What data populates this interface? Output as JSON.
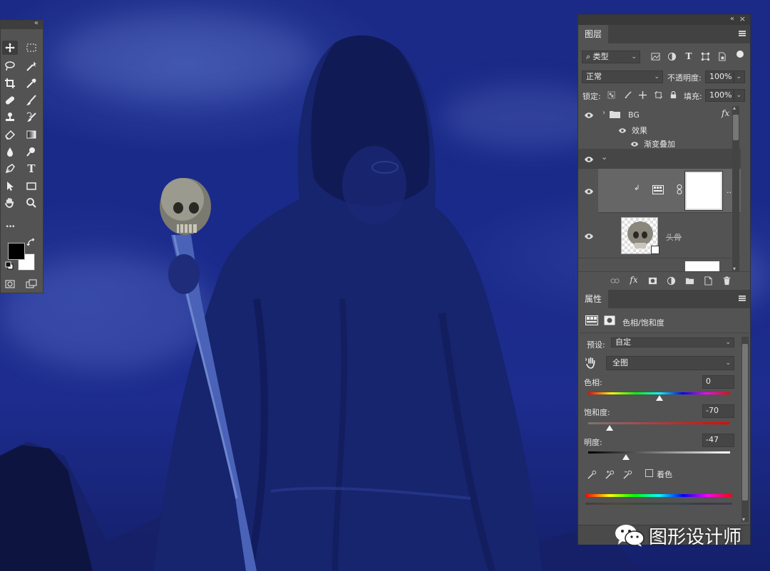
{
  "toolbox": {
    "collapse_glyph": "«",
    "tools": [
      {
        "name": "move-tool-icon"
      },
      {
        "name": "marquee-tool-icon"
      },
      {
        "name": "lasso-tool-icon"
      },
      {
        "name": "magic-wand-tool-icon"
      },
      {
        "name": "crop-tool-icon"
      },
      {
        "name": "eyedropper-tool-icon"
      },
      {
        "name": "healing-brush-tool-icon"
      },
      {
        "name": "brush-tool-icon"
      },
      {
        "name": "clone-stamp-tool-icon"
      },
      {
        "name": "history-brush-tool-icon"
      },
      {
        "name": "eraser-tool-icon"
      },
      {
        "name": "gradient-tool-icon"
      },
      {
        "name": "blur-tool-icon"
      },
      {
        "name": "dodge-tool-icon"
      },
      {
        "name": "pen-tool-icon"
      },
      {
        "name": "type-tool-icon"
      },
      {
        "name": "path-selection-tool-icon"
      },
      {
        "name": "rectangle-tool-icon"
      },
      {
        "name": "hand-tool-icon"
      },
      {
        "name": "zoom-tool-icon"
      }
    ],
    "type_glyph": "T",
    "more_glyph": "•••",
    "foreground_color": "#000000",
    "background_color": "#ffffff"
  },
  "layers_panel": {
    "collapse_glyph": "«",
    "close_glyph": "×",
    "tab_label": "图层",
    "filter_kind": "类型",
    "blend_mode": "正常",
    "opacity_label": "不透明度:",
    "opacity_value": "100%",
    "lock_label": "锁定:",
    "fill_label": "填充:",
    "fill_value": "100%",
    "layers": [
      {
        "name": "BG",
        "fx": "fx",
        "effects_label": "效果",
        "effect_item": "渐变叠加"
      },
      {
        "name": "",
        "type": "group-expanded"
      },
      {
        "name": "",
        "type": "hue-saturation-adjustment",
        "more": "..."
      },
      {
        "name": "头骨",
        "type": "smart-object"
      }
    ],
    "footer_fx": "fx"
  },
  "properties_panel": {
    "tab_label": "属性",
    "adjustment_title": "色相/饱和度",
    "preset_label": "预设:",
    "preset_value": "自定",
    "range_value": "全图",
    "hue_label": "色相:",
    "hue_value": "0",
    "saturation_label": "饱和度:",
    "saturation_value": "-70",
    "lightness_label": "明度:",
    "lightness_value": "-47",
    "colorize_label": "着色",
    "colorize_checked": false,
    "hue_slider_fraction": 0.5,
    "saturation_slider_fraction": 0.15,
    "lightness_slider_fraction": 0.265
  },
  "watermark": {
    "text": "图形设计师",
    "icon": "wechat-icon"
  }
}
